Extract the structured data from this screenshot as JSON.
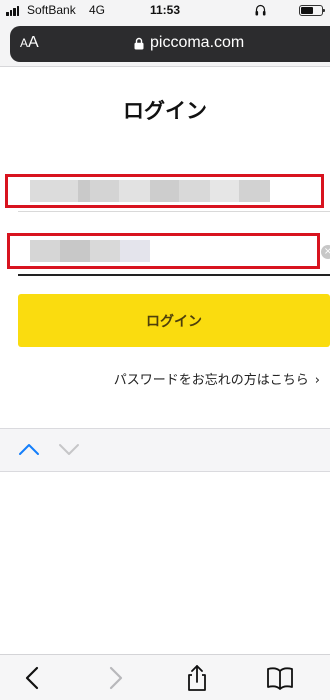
{
  "status_bar": {
    "carrier": "SoftBank",
    "network": "4G",
    "time": "11:53",
    "icons": [
      "signal-icon",
      "headphones-icon",
      "battery-icon"
    ]
  },
  "address_bar": {
    "text_size_small": "A",
    "text_size_big": "A",
    "url": "piccoma.com",
    "icons": [
      "lock-icon"
    ]
  },
  "page": {
    "title": "ログイン",
    "email_field": {
      "value": "",
      "placeholder": ""
    },
    "password_field": {
      "value": "",
      "placeholder": ""
    },
    "login_button_label": "ログイン",
    "forgot_password_label": "パスワードをお忘れの方はこちら",
    "forgot_chevron": "›"
  },
  "form_assistant": {
    "icons": [
      "chevron-up-icon",
      "chevron-down-icon"
    ]
  },
  "toolbar": {
    "icons": [
      "back-icon",
      "forward-icon",
      "share-icon",
      "bookmarks-icon"
    ]
  },
  "colors": {
    "accent_yellow": "#FADC0F",
    "highlight_red": "#D8131F",
    "safari_blue": "#147EFB",
    "address_pill": "#2C2C2E"
  }
}
